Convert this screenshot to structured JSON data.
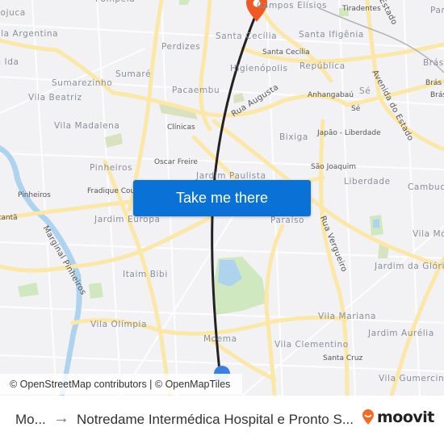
{
  "map": {
    "neighborhood_labels": [
      {
        "text": "Pompeia"
      },
      {
        "text": "Pojuca"
      },
      {
        "text": "Vila Argentina"
      },
      {
        "text": "Vila Ida"
      },
      {
        "text": "Perdizes"
      },
      {
        "text": "Sumaré"
      },
      {
        "text": "Sumarezinho"
      },
      {
        "text": "Pacaembu"
      },
      {
        "text": "Vila Beatriz"
      },
      {
        "text": "Vila Madalena"
      },
      {
        "text": "Campos Elísios"
      },
      {
        "text": "Santa Cecília"
      },
      {
        "text": "Santa Ifigênia"
      },
      {
        "text": "Higienópolis"
      },
      {
        "text": "República"
      },
      {
        "text": "Sé"
      },
      {
        "text": "Bixiga"
      },
      {
        "text": "Pinheiros"
      },
      {
        "text": "Jardim Paulista"
      },
      {
        "text": "Liberdade"
      },
      {
        "text": "Cambuci"
      },
      {
        "text": "Jardim Europa"
      },
      {
        "text": "Paraíso"
      },
      {
        "text": "Vila Mo"
      },
      {
        "text": "Itaim Bibi"
      },
      {
        "text": "Jardim da Glória"
      },
      {
        "text": "Vila Olímpia"
      },
      {
        "text": "Vila Mariana"
      },
      {
        "text": "Jardim Aurélia"
      },
      {
        "text": "Moema"
      },
      {
        "text": "Vila Clementino"
      },
      {
        "text": "Vila Gumercind"
      },
      {
        "text": "Brás"
      },
      {
        "text": "Par"
      }
    ],
    "station_labels": [
      {
        "text": "Tiradentes"
      },
      {
        "text": "Santa Cecília"
      },
      {
        "text": "Anhangabaú"
      },
      {
        "text": "Sé"
      },
      {
        "text": "Japão - Liberdade"
      },
      {
        "text": "Clínicas"
      },
      {
        "text": "Oscar Freire"
      },
      {
        "text": "São Joaquim"
      },
      {
        "text": "Fradique Coutinho"
      },
      {
        "text": "Pinheiros"
      },
      {
        "text": "Butantã"
      },
      {
        "text": "Santa Cruz"
      },
      {
        "text": "Brás"
      },
      {
        "text": "Brás"
      }
    ],
    "street_labels": [
      {
        "text": "Rua Augusta"
      },
      {
        "text": "Avenida do Estado"
      },
      {
        "text": "Rua Vergueiro"
      },
      {
        "text": "Marginal Pinheiros"
      },
      {
        "text": "Estado"
      }
    ],
    "colors": {
      "background": "#f2f2f4",
      "major_road": "#fbe7a6",
      "minor_road": "#ffffff",
      "park": "#cfe8bf",
      "water": "#aed3ef",
      "route_line": "#222222",
      "destination_pin": "#f05a22",
      "origin_dot": "#3a7fe6"
    }
  },
  "cta": {
    "label": "Take me there",
    "color": "#0a72d6"
  },
  "attribution": {
    "text": "© OpenStreetMap contributors | © OpenMapTiles"
  },
  "footer": {
    "from_label": "Mo...",
    "arrow": "→",
    "to_label": "Notredame Intermédica Hospital e Pronto S...",
    "brand": "moovit",
    "brand_color": "#f46a25"
  }
}
